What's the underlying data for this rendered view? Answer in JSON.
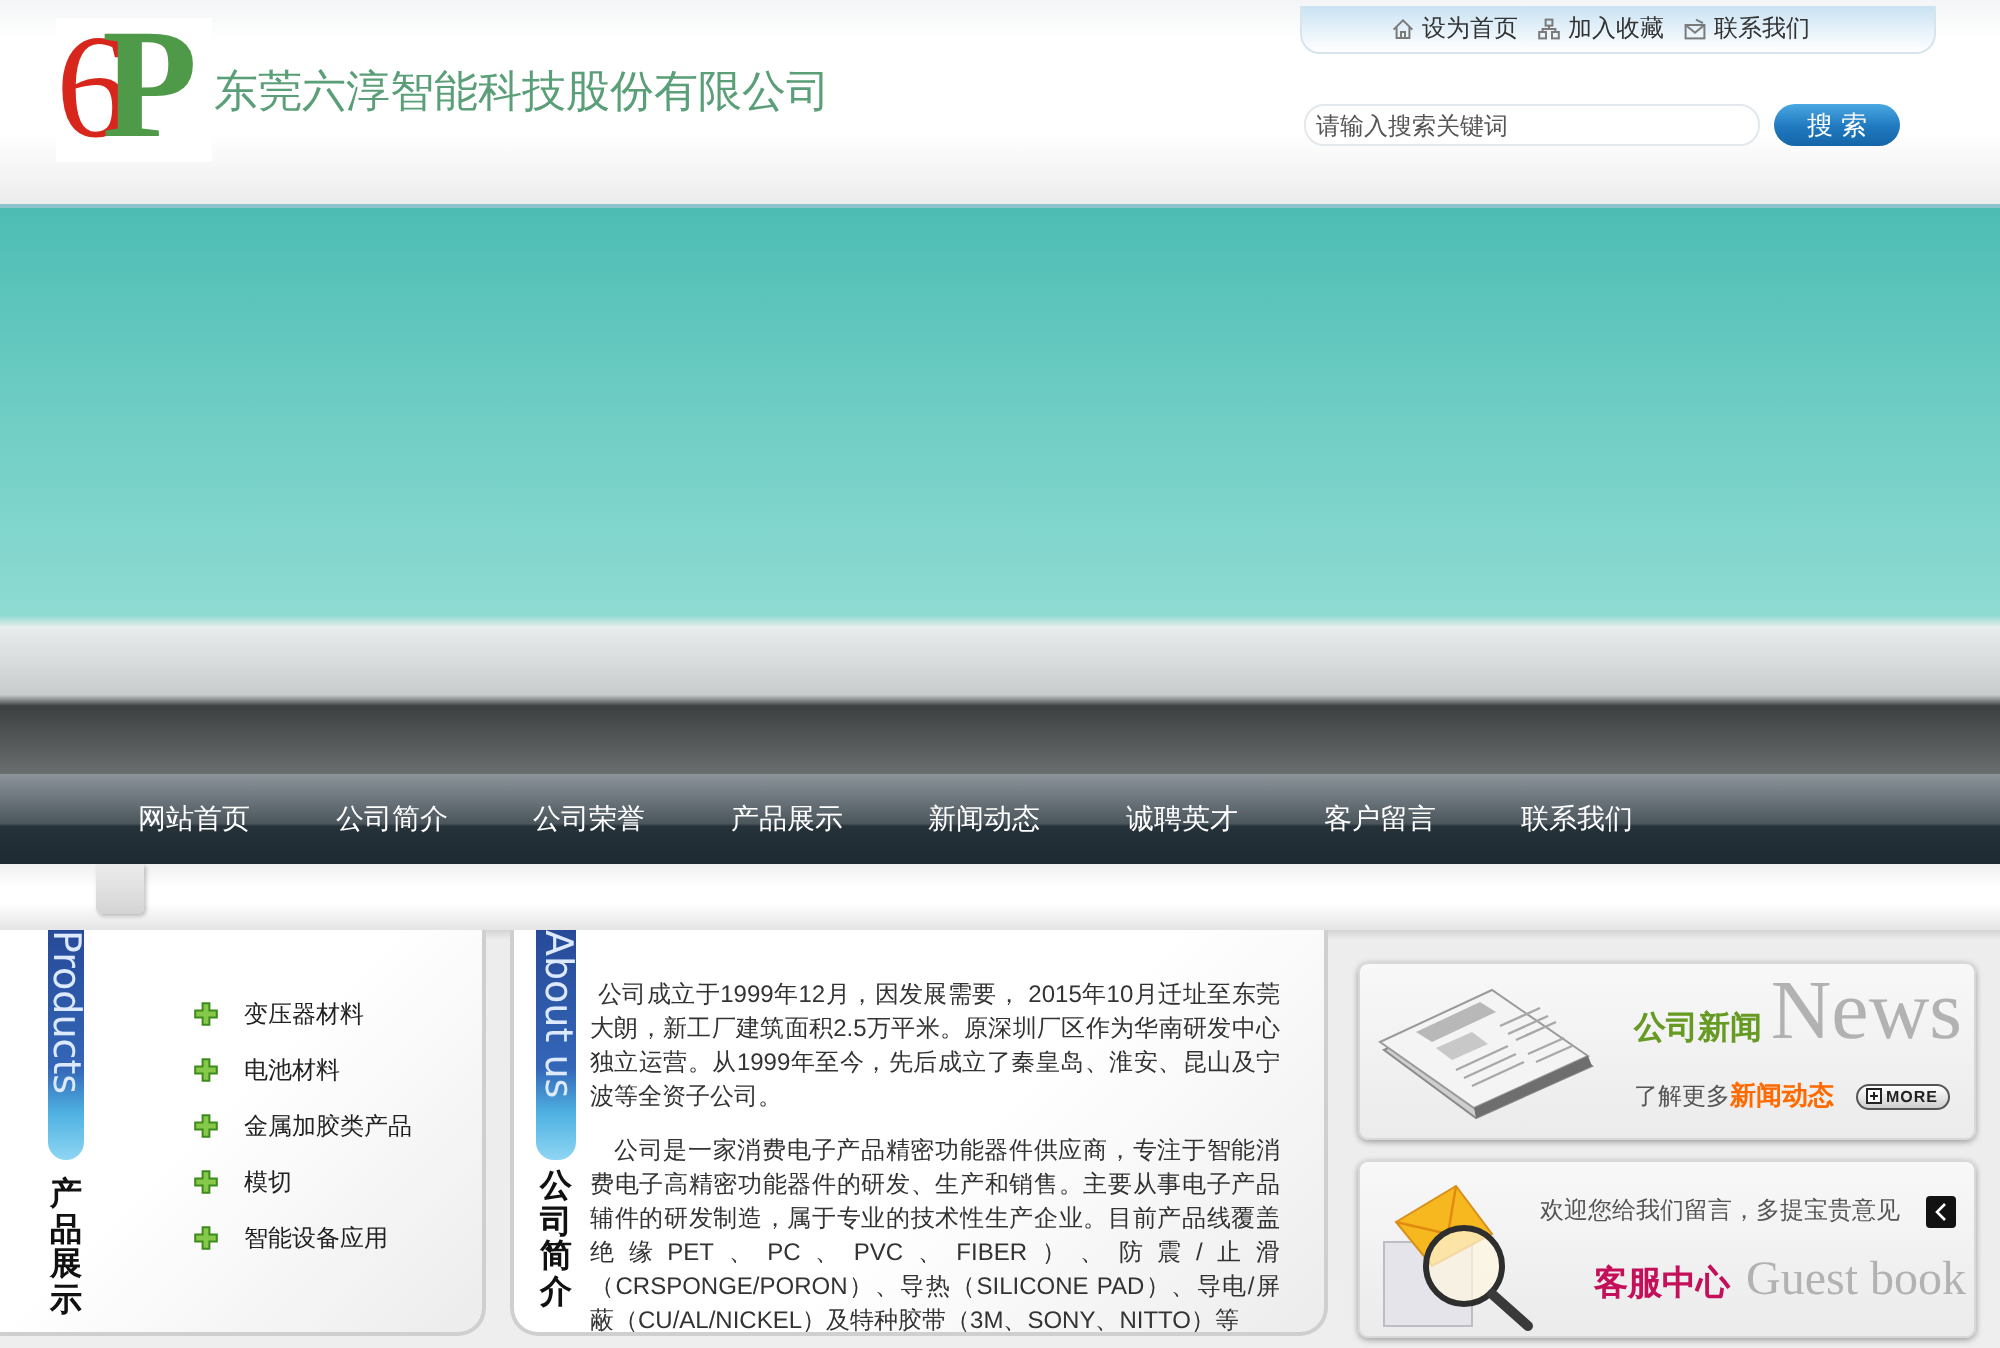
{
  "header": {
    "logo_letters": [
      "6",
      "P"
    ],
    "company_name": "东莞六淳智能科技股份有限公司",
    "top_links": [
      {
        "kind": "home",
        "label": "设为首页"
      },
      {
        "kind": "bookmark",
        "label": "加入收藏"
      },
      {
        "kind": "contact",
        "label": "联系我们"
      }
    ],
    "search": {
      "placeholder": "请输入搜索关键词",
      "button": "搜 索"
    }
  },
  "nav": {
    "items": [
      "网站首页",
      "公司简介",
      "公司荣誉",
      "产品展示",
      "新闻动态",
      "诚聘英才",
      "客户留言",
      "联系我们"
    ]
  },
  "products": {
    "tag": "Products",
    "title": "产品展示",
    "items": [
      "变压器材料",
      "电池材料",
      "金属加胶类产品",
      "模切",
      "智能设备应用"
    ]
  },
  "about": {
    "tag": "About us",
    "title": "公司简介",
    "paragraphs": [
      "公司成立于1999年12月，因发展需要， 2015年10月迁址至东莞大朗，新工厂建筑面积2.5万平米。原深圳厂区作为华南研发中心独立运营。从1999年至今，先后成立了秦皇岛、淮安、昆山及宁波等全资子公司。",
      "公司是一家消费电子产品精密功能器件供应商，专注于智能消费电子高精密功能器件的研发、生产和销售。主要从事电子产品辅件的研发制造，属于专业的技术性生产企业。目前产品线覆盖绝缘PET、PC、PVC、FIBER）、防震/止滑（CRSPONGE/PORON）、导热（SILICONE PAD）、导电/屏蔽（CU/AL/NICKEL）及特种胶带（3M、SONY、NITTO）等"
    ]
  },
  "news": {
    "background_word": "News",
    "title": "公司新闻",
    "lead": "了解更多",
    "highlight": "新闻动态",
    "more_button": "MORE"
  },
  "guestbook": {
    "message": "欢迎您给我们留言，多提宝贵意见",
    "background_word": "Guest book",
    "title": "客服中心"
  }
}
